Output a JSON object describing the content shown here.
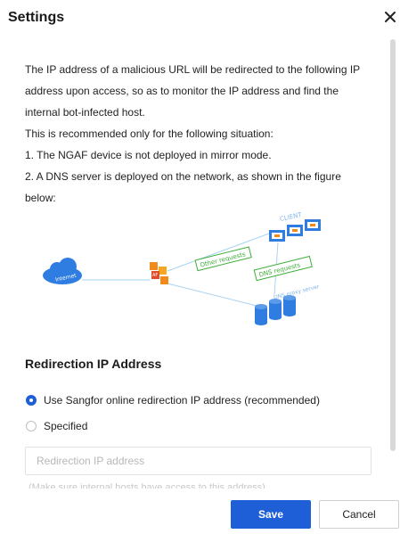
{
  "dialog": {
    "title": "Settings"
  },
  "description": {
    "lines": [
      "The IP address of a malicious URL will be redirected to the following IP",
      "address upon access, so as to monitor the IP address and find the",
      "internal bot-infected host.",
      "This is recommended only for the following situation:",
      "1. The NGAF device is not deployed in mirror mode.",
      "2. A DNS server is deployed on the network, as shown in the figure",
      "below:"
    ]
  },
  "diagram": {
    "internet": "Internet",
    "client": "CLIENT",
    "device": "AF",
    "other_requests": "Other requests",
    "dns_requests": "DNS requests",
    "dns_proxy": "DNS proxy server"
  },
  "redirection": {
    "section_title": "Redirection IP Address",
    "options": [
      {
        "label": "Use Sangfor online redirection IP address (recommended)",
        "checked": true
      },
      {
        "label": "Specified",
        "checked": false
      }
    ],
    "input": {
      "value": "",
      "placeholder": "Redirection IP address"
    },
    "hint": "(Make sure internal hosts have access to this address)"
  },
  "footer": {
    "save_label": "Save",
    "cancel_label": "Cancel"
  },
  "colors": {
    "primary": "#1e5fd8",
    "diagram_blue": "#2f7de1",
    "diagram_green": "#3fae3a",
    "device_orange": "#f08a1c"
  }
}
